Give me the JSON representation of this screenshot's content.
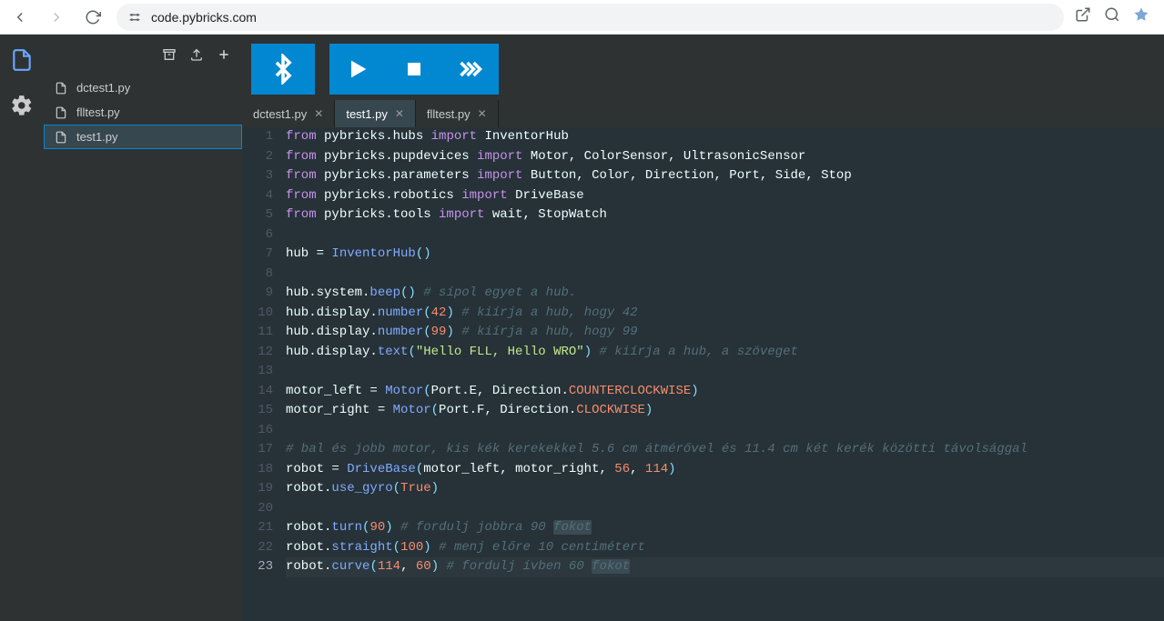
{
  "browser": {
    "url": "code.pybricks.com"
  },
  "sidebar": {
    "files": [
      "dctest1.py",
      "flltest.py",
      "test1.py"
    ],
    "selected_index": 2
  },
  "tabs": {
    "items": [
      "dctest1.py",
      "test1.py",
      "flltest.py"
    ],
    "active_index": 1
  },
  "code": {
    "lines": [
      [
        {
          "t": "kw",
          "v": "from"
        },
        {
          "t": "var",
          "v": " pybricks.hubs "
        },
        {
          "t": "kw",
          "v": "import"
        },
        {
          "t": "var",
          "v": " InventorHub"
        }
      ],
      [
        {
          "t": "kw",
          "v": "from"
        },
        {
          "t": "var",
          "v": " pybricks.pupdevices "
        },
        {
          "t": "kw",
          "v": "import"
        },
        {
          "t": "var",
          "v": " Motor, ColorSensor, UltrasonicSensor"
        }
      ],
      [
        {
          "t": "kw",
          "v": "from"
        },
        {
          "t": "var",
          "v": " pybricks.parameters "
        },
        {
          "t": "kw",
          "v": "import"
        },
        {
          "t": "var",
          "v": " Button, Color, Direction, Port, Side, Stop"
        }
      ],
      [
        {
          "t": "kw",
          "v": "from"
        },
        {
          "t": "var",
          "v": " pybricks.robotics "
        },
        {
          "t": "kw",
          "v": "import"
        },
        {
          "t": "var",
          "v": " DriveBase"
        }
      ],
      [
        {
          "t": "kw",
          "v": "from"
        },
        {
          "t": "var",
          "v": " pybricks.tools "
        },
        {
          "t": "kw",
          "v": "import"
        },
        {
          "t": "var",
          "v": " wait, StopWatch"
        }
      ],
      [],
      [
        {
          "t": "var",
          "v": "hub = "
        },
        {
          "t": "fn",
          "v": "InventorHub"
        },
        {
          "t": "punct",
          "v": "()"
        }
      ],
      [],
      [
        {
          "t": "var",
          "v": "hub.system."
        },
        {
          "t": "fn",
          "v": "beep"
        },
        {
          "t": "punct",
          "v": "()"
        },
        {
          "t": "var",
          "v": " "
        },
        {
          "t": "cmt",
          "v": "# sípol egyet a hub."
        }
      ],
      [
        {
          "t": "var",
          "v": "hub.display."
        },
        {
          "t": "fn",
          "v": "number"
        },
        {
          "t": "punct",
          "v": "("
        },
        {
          "t": "num",
          "v": "42"
        },
        {
          "t": "punct",
          "v": ")"
        },
        {
          "t": "var",
          "v": " "
        },
        {
          "t": "cmt",
          "v": "# kiírja a hub, hogy 42"
        }
      ],
      [
        {
          "t": "var",
          "v": "hub.display."
        },
        {
          "t": "fn",
          "v": "number"
        },
        {
          "t": "punct",
          "v": "("
        },
        {
          "t": "num",
          "v": "99"
        },
        {
          "t": "punct",
          "v": ")"
        },
        {
          "t": "var",
          "v": " "
        },
        {
          "t": "cmt",
          "v": "# kiírja a hub, hogy 99"
        }
      ],
      [
        {
          "t": "var",
          "v": "hub.display."
        },
        {
          "t": "fn",
          "v": "text"
        },
        {
          "t": "punct",
          "v": "("
        },
        {
          "t": "str",
          "v": "\"Hello FLL, Hello WRO\""
        },
        {
          "t": "punct",
          "v": ")"
        },
        {
          "t": "var",
          "v": " "
        },
        {
          "t": "cmt",
          "v": "# kiírja a hub, a szöveget"
        }
      ],
      [],
      [
        {
          "t": "var",
          "v": "motor_left = "
        },
        {
          "t": "fn",
          "v": "Motor"
        },
        {
          "t": "punct",
          "v": "("
        },
        {
          "t": "var",
          "v": "Port.E, Direction."
        },
        {
          "t": "const",
          "v": "COUNTERCLOCKWISE"
        },
        {
          "t": "punct",
          "v": ")"
        }
      ],
      [
        {
          "t": "var",
          "v": "motor_right = "
        },
        {
          "t": "fn",
          "v": "Motor"
        },
        {
          "t": "punct",
          "v": "("
        },
        {
          "t": "var",
          "v": "Port.F, Direction."
        },
        {
          "t": "const",
          "v": "CLOCKWISE"
        },
        {
          "t": "punct",
          "v": ")"
        }
      ],
      [],
      [
        {
          "t": "cmt",
          "v": "# bal és jobb motor, kis kék kerekekkel 5.6 cm átmérővel és 11.4 cm két kerék közötti távolsággal"
        }
      ],
      [
        {
          "t": "var",
          "v": "robot = "
        },
        {
          "t": "fn",
          "v": "DriveBase"
        },
        {
          "t": "punct",
          "v": "("
        },
        {
          "t": "var",
          "v": "motor_left, motor_right, "
        },
        {
          "t": "num",
          "v": "56"
        },
        {
          "t": "var",
          "v": ", "
        },
        {
          "t": "num",
          "v": "114"
        },
        {
          "t": "punct",
          "v": ")"
        }
      ],
      [
        {
          "t": "var",
          "v": "robot."
        },
        {
          "t": "fn",
          "v": "use_gyro"
        },
        {
          "t": "punct",
          "v": "("
        },
        {
          "t": "const",
          "v": "True"
        },
        {
          "t": "punct",
          "v": ")"
        }
      ],
      [],
      [
        {
          "t": "var",
          "v": "robot."
        },
        {
          "t": "fn",
          "v": "turn"
        },
        {
          "t": "punct",
          "v": "("
        },
        {
          "t": "num",
          "v": "90"
        },
        {
          "t": "punct",
          "v": ")"
        },
        {
          "t": "var",
          "v": " "
        },
        {
          "t": "cmt",
          "v": "# fordulj jobbra 90 "
        },
        {
          "t": "cmt sel",
          "v": "fokot"
        }
      ],
      [
        {
          "t": "var",
          "v": "robot."
        },
        {
          "t": "fn",
          "v": "straight"
        },
        {
          "t": "punct",
          "v": "("
        },
        {
          "t": "num",
          "v": "100"
        },
        {
          "t": "punct",
          "v": ")"
        },
        {
          "t": "var",
          "v": " "
        },
        {
          "t": "cmt",
          "v": "# menj előre 10 centimétert"
        }
      ],
      [
        {
          "t": "var",
          "v": "robot."
        },
        {
          "t": "fn",
          "v": "curve"
        },
        {
          "t": "punct",
          "v": "("
        },
        {
          "t": "num",
          "v": "114"
        },
        {
          "t": "var",
          "v": ", "
        },
        {
          "t": "num",
          "v": "60"
        },
        {
          "t": "punct",
          "v": ")"
        },
        {
          "t": "var",
          "v": " "
        },
        {
          "t": "cmt",
          "v": "# fordulj ívben 60 "
        },
        {
          "t": "cmt sel",
          "v": "fokot"
        }
      ]
    ],
    "current_line": 23
  }
}
